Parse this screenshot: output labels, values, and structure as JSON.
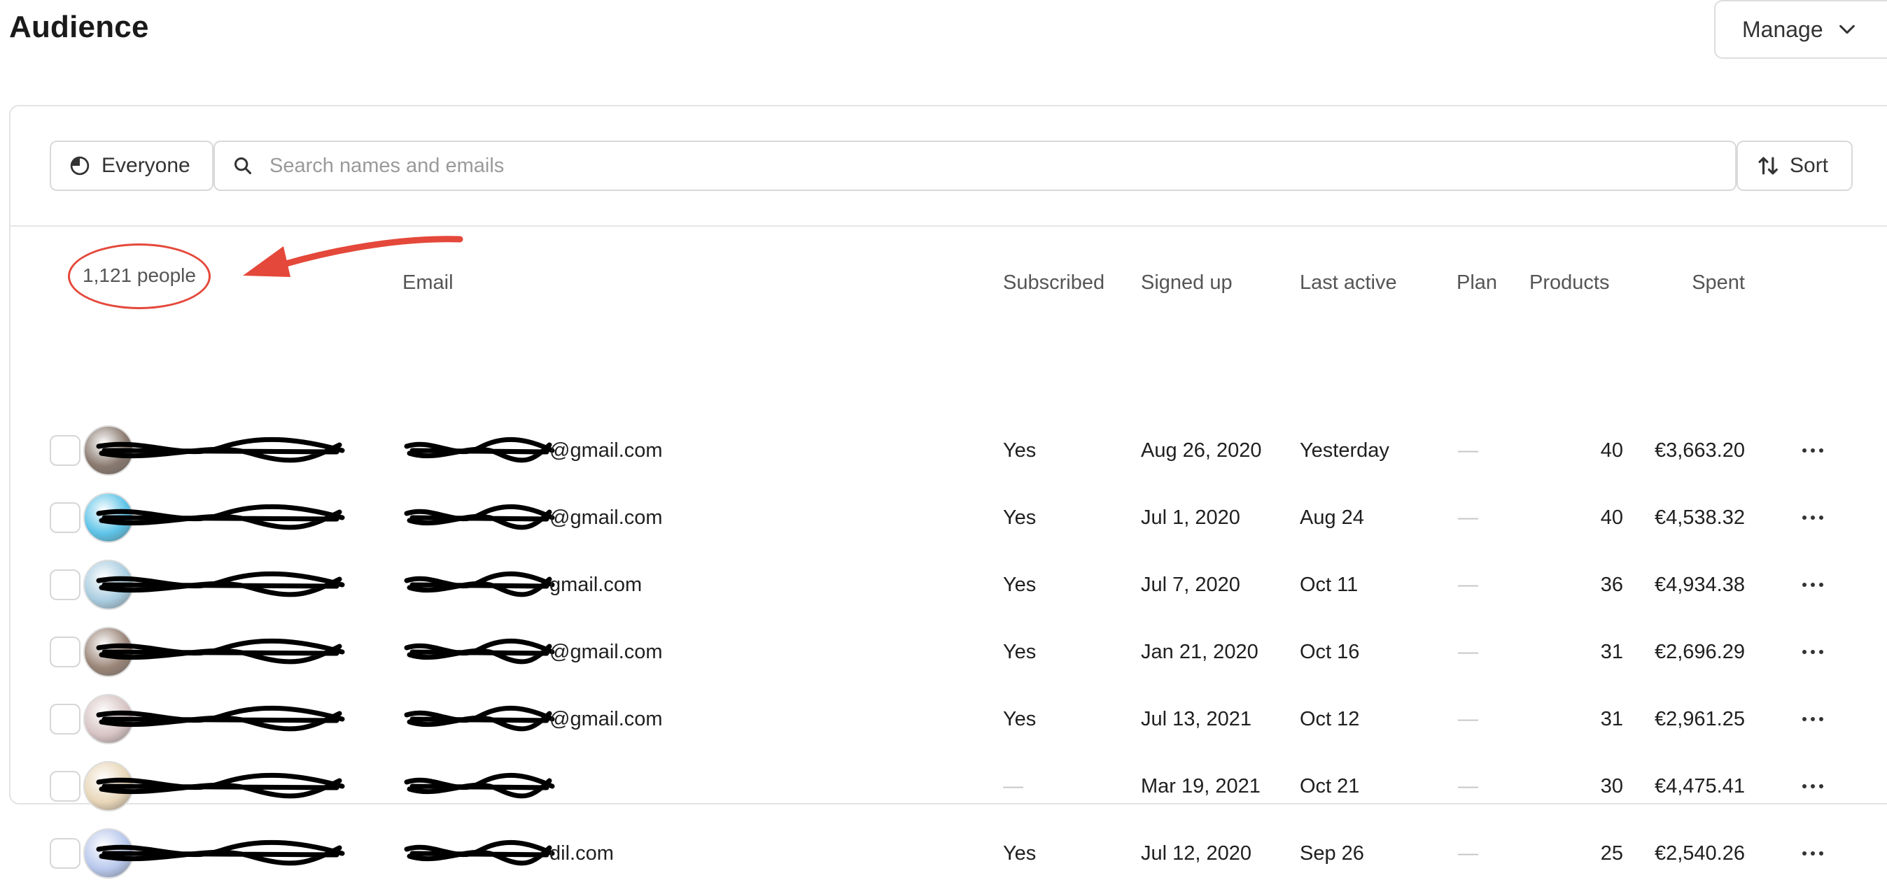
{
  "page": {
    "title": "Audience"
  },
  "header": {
    "manage_label": "Manage"
  },
  "toolbar": {
    "segment_label": "Everyone",
    "search_placeholder": "Search names and emails",
    "sort_label": "Sort"
  },
  "summary": {
    "count_label": "1,121 people"
  },
  "columns": {
    "email": "Email",
    "subscribed": "Subscribed",
    "signed_up": "Signed up",
    "last_active": "Last active",
    "plan": "Plan",
    "products": "Products",
    "spent": "Spent"
  },
  "colors": {
    "accent": "#e4483a",
    "border": "#d9d9d9",
    "muted": "#555555"
  },
  "rows": [
    {
      "email_visible": "@gmail.com",
      "subscribed": "Yes",
      "signed_up": "Aug 26, 2020",
      "last_active": "Yesterday",
      "plan": "—",
      "products": "40",
      "spent": "€3,663.20",
      "avatar_color": "#8a7a70"
    },
    {
      "email_visible": "@gmail.com",
      "subscribed": "Yes",
      "signed_up": "Jul 1, 2020",
      "last_active": "Aug 24",
      "plan": "—",
      "products": "40",
      "spent": "€4,538.32",
      "avatar_color": "#5ec4e8"
    },
    {
      "email_visible": "gmail.com",
      "subscribed": "Yes",
      "signed_up": "Jul 7, 2020",
      "last_active": "Oct 11",
      "plan": "—",
      "products": "36",
      "spent": "€4,934.38",
      "avatar_color": "#a9cde0"
    },
    {
      "email_visible": "@gmail.com",
      "subscribed": "Yes",
      "signed_up": "Jan 21, 2020",
      "last_active": "Oct 16",
      "plan": "—",
      "products": "31",
      "spent": "€2,696.29",
      "avatar_color": "#9b8679"
    },
    {
      "email_visible": "@gmail.com",
      "subscribed": "Yes",
      "signed_up": "Jul 13, 2021",
      "last_active": "Oct 12",
      "plan": "—",
      "products": "31",
      "spent": "€2,961.25",
      "avatar_color": "#d8c4c4"
    },
    {
      "email_visible": "",
      "subscribed": "—",
      "signed_up": "Mar 19, 2021",
      "last_active": "Oct 21",
      "plan": "—",
      "products": "30",
      "spent": "€4,475.41",
      "avatar_color": "#e8d6b8"
    },
    {
      "email_visible": "dil.com",
      "subscribed": "Yes",
      "signed_up": "Jul 12, 2020",
      "last_active": "Sep 26",
      "plan": "—",
      "products": "25",
      "spent": "€2,540.26",
      "avatar_color": "#b8c8ec"
    }
  ]
}
